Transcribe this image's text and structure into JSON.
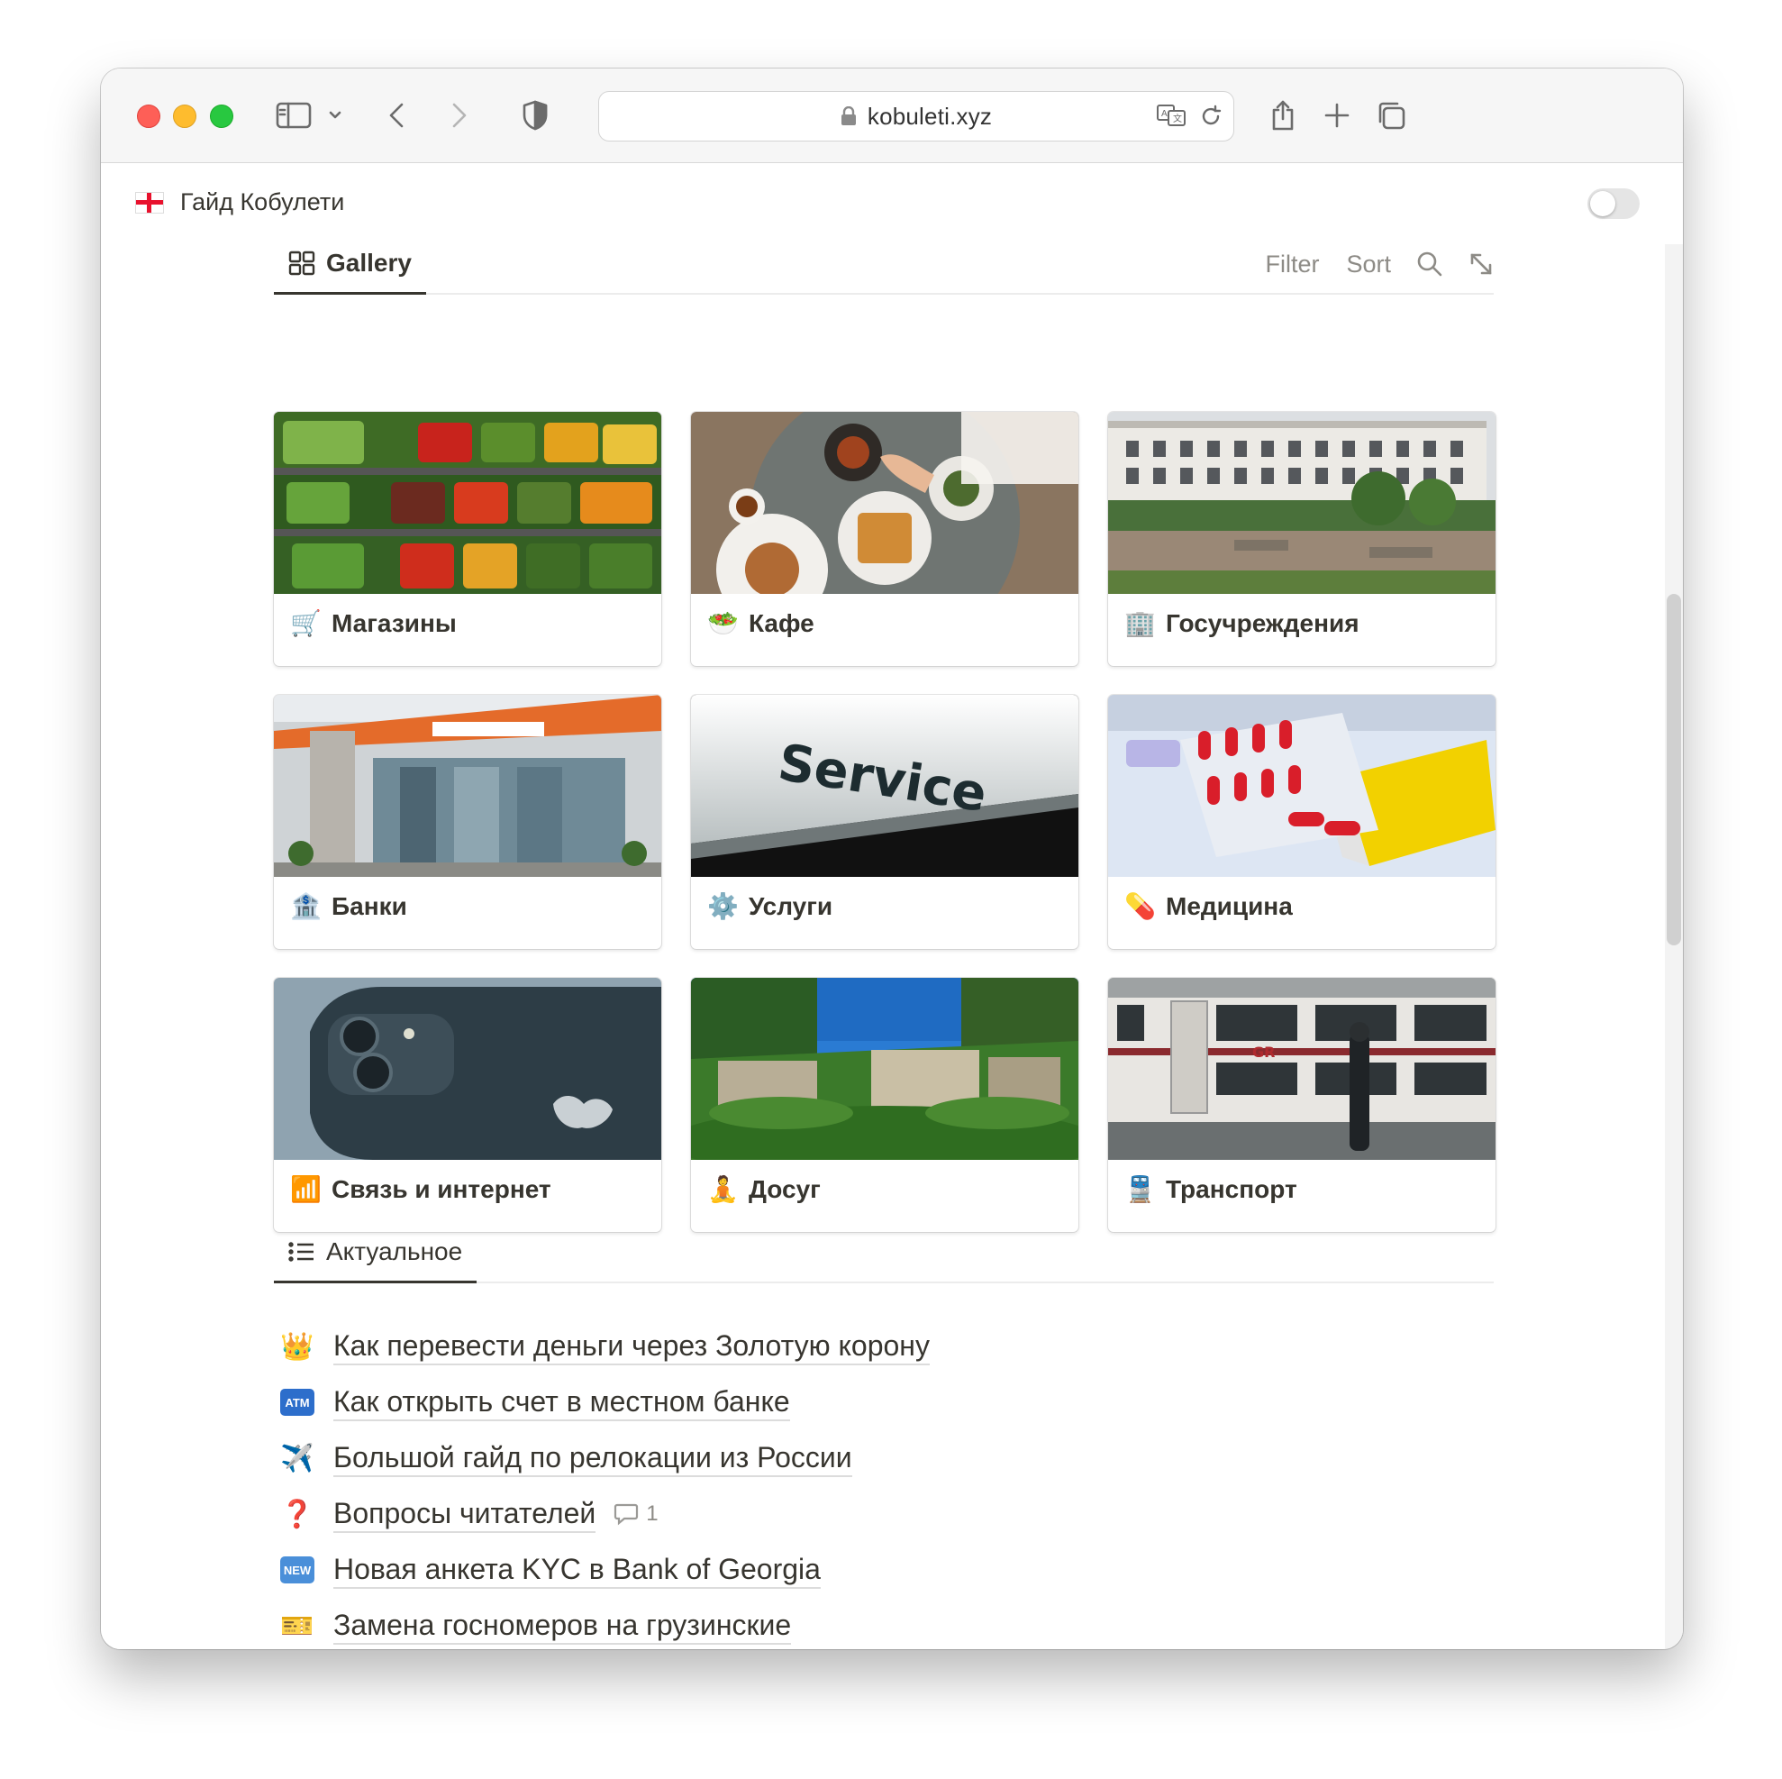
{
  "browser": {
    "url": "kobuleti.xyz"
  },
  "page": {
    "title": "Гайд Кобулети"
  },
  "gallery": {
    "tab_label": "Gallery",
    "filter_label": "Filter",
    "sort_label": "Sort",
    "cards": [
      {
        "emoji": "🛒",
        "label": "Магазины"
      },
      {
        "emoji": "🥗",
        "label": "Кафе"
      },
      {
        "emoji": "🏢",
        "label": "Госучреждения"
      },
      {
        "emoji": "🏦",
        "label": "Банки"
      },
      {
        "emoji": "⚙️",
        "label": "Услуги"
      },
      {
        "emoji": "💊",
        "label": "Медицина"
      },
      {
        "emoji": "📶",
        "label": "Связь и интернет"
      },
      {
        "emoji": "🧘",
        "label": "Досуг"
      },
      {
        "emoji": "🚆",
        "label": "Транспорт"
      }
    ],
    "cover_text": "Service"
  },
  "list": {
    "tab_label": "Актуальное",
    "items": [
      {
        "emoji": "👑",
        "text": "Как перевести деньги через Золотую корону"
      },
      {
        "emoji": "ATM",
        "text": "Как открыть счет в местном банке"
      },
      {
        "emoji": "✈️",
        "text": "Большой гайд по релокации из России"
      },
      {
        "emoji": "❓",
        "text": "Вопросы читателей",
        "comments": "1"
      },
      {
        "emoji": "NEW",
        "text": "Новая анкета KYC в Bank of Georgia"
      },
      {
        "emoji": "🎫",
        "text": "Замена госномеров на грузинские"
      }
    ]
  }
}
